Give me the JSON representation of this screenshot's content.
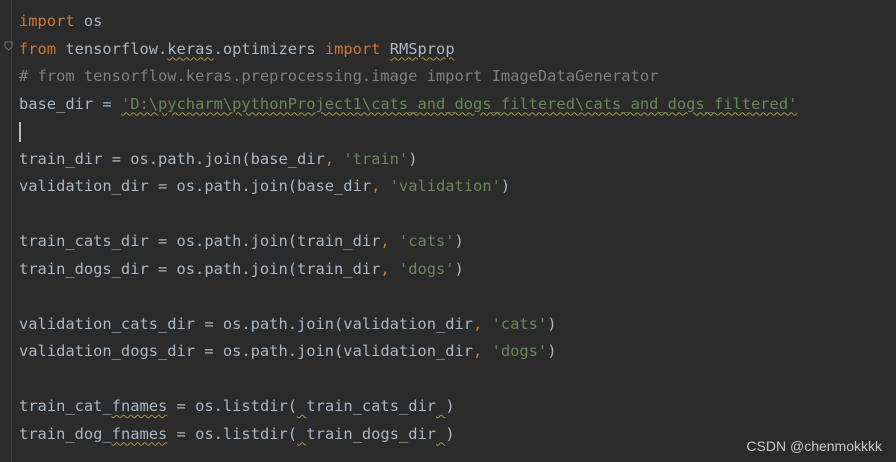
{
  "editor": {
    "lines": [
      {
        "tokens": [
          {
            "t": "import",
            "c": "kw"
          },
          {
            "t": " os",
            "c": "plain"
          }
        ]
      },
      {
        "tokens": [
          {
            "t": "from",
            "c": "kw"
          },
          {
            "t": " tensorflow.",
            "c": "plain"
          },
          {
            "t": "keras",
            "c": "plain",
            "sq": true
          },
          {
            "t": ".optimizers ",
            "c": "plain"
          },
          {
            "t": "import",
            "c": "kw"
          },
          {
            "t": " ",
            "c": "plain"
          },
          {
            "t": "RMSprop",
            "c": "plain",
            "sq": true
          }
        ]
      },
      {
        "tokens": [
          {
            "t": "# from tensorflow.keras.preprocessing.image import ImageDataGenerator",
            "c": "cm"
          }
        ]
      },
      {
        "tokens": [
          {
            "t": "base_dir = ",
            "c": "plain"
          },
          {
            "t": "'D:\\pycharm\\pythonProject1\\cats_and_dogs_filtered\\cats_and_dogs_filtered'",
            "c": "str",
            "sq": true
          }
        ]
      },
      {
        "caret": true,
        "tokens": []
      },
      {
        "tokens": [
          {
            "t": "train_dir = os.path.join(base_dir",
            "c": "plain"
          },
          {
            "t": ", ",
            "c": "kw"
          },
          {
            "t": "'train'",
            "c": "str"
          },
          {
            "t": ")",
            "c": "plain"
          }
        ]
      },
      {
        "tokens": [
          {
            "t": "validation_dir = os.path.join(base_dir",
            "c": "plain"
          },
          {
            "t": ", ",
            "c": "kw"
          },
          {
            "t": "'validation'",
            "c": "str"
          },
          {
            "t": ")",
            "c": "plain"
          }
        ]
      },
      {
        "tokens": []
      },
      {
        "tokens": [
          {
            "t": "train_cats_dir = os.path.join(train_dir",
            "c": "plain"
          },
          {
            "t": ", ",
            "c": "kw"
          },
          {
            "t": "'cats'",
            "c": "str"
          },
          {
            "t": ")",
            "c": "plain"
          }
        ]
      },
      {
        "tokens": [
          {
            "t": "train_dogs_dir = os.path.join(train_dir",
            "c": "plain"
          },
          {
            "t": ", ",
            "c": "kw"
          },
          {
            "t": "'dogs'",
            "c": "str"
          },
          {
            "t": ")",
            "c": "plain"
          }
        ]
      },
      {
        "tokens": []
      },
      {
        "tokens": [
          {
            "t": "validation_cats_dir = os.path.join(validation_dir",
            "c": "plain"
          },
          {
            "t": ", ",
            "c": "kw"
          },
          {
            "t": "'cats'",
            "c": "str"
          },
          {
            "t": ")",
            "c": "plain"
          }
        ]
      },
      {
        "tokens": [
          {
            "t": "validation_dogs_dir = os.path.join(validation_dir",
            "c": "plain"
          },
          {
            "t": ", ",
            "c": "kw"
          },
          {
            "t": "'dogs'",
            "c": "str"
          },
          {
            "t": ")",
            "c": "plain"
          }
        ]
      },
      {
        "tokens": []
      },
      {
        "tokens": [
          {
            "t": "train_cat_",
            "c": "plain"
          },
          {
            "t": "fnames",
            "c": "plain",
            "sq": true
          },
          {
            "t": " = os.listdir(",
            "c": "plain"
          },
          {
            "t": " ",
            "c": "plain",
            "sq": true
          },
          {
            "t": "train_cats_dir",
            "c": "plain"
          },
          {
            "t": " ",
            "c": "plain",
            "sq": true
          },
          {
            "t": ")",
            "c": "plain"
          }
        ]
      },
      {
        "tokens": [
          {
            "t": "train_dog_",
            "c": "plain"
          },
          {
            "t": "fnames",
            "c": "plain",
            "sq": true
          },
          {
            "t": " = os.listdir(",
            "c": "plain"
          },
          {
            "t": " ",
            "c": "plain",
            "sq": true
          },
          {
            "t": "train_dogs_dir",
            "c": "plain"
          },
          {
            "t": " ",
            "c": "plain",
            "sq": true
          },
          {
            "t": ")",
            "c": "plain"
          }
        ]
      }
    ]
  },
  "watermark": "CSDN @chenmokkkk",
  "colors": {
    "background": "#2b2b2b",
    "keyword": "#cc7832",
    "string": "#6a8759",
    "comment": "#808080",
    "text": "#a9b7c6"
  }
}
